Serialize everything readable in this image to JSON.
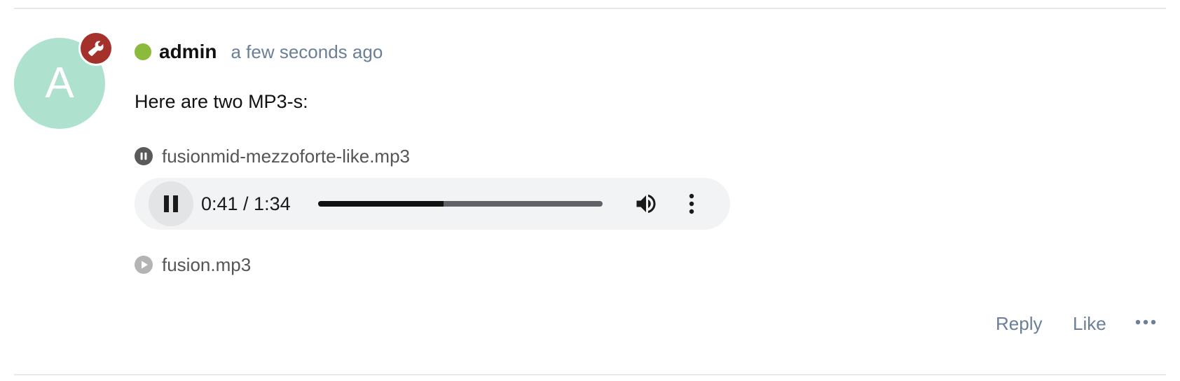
{
  "comment": {
    "avatar_letter": "A",
    "author": "admin",
    "timestamp": "a few seconds ago",
    "text": "Here are two MP3-s:",
    "presence_color": "#8bbb3d",
    "badge_icon": "wrench-icon",
    "badge_color": "#a5312b",
    "avatar_color": "#aee2cf"
  },
  "attachments": [
    {
      "name": "fusionmid-mezzoforte-like.mp3",
      "state_icon": "pause-circle-icon",
      "playing": true
    },
    {
      "name": "fusion.mp3",
      "state_icon": "play-circle-icon",
      "playing": false
    }
  ],
  "player": {
    "time_display": "0:41 / 1:34",
    "progress_fraction": 0.44,
    "control_icons": [
      "pause-icon",
      "volume-icon",
      "more-vertical-icon"
    ]
  },
  "actions": {
    "reply": "Reply",
    "like": "Like",
    "more_icon": "more-horizontal-icon"
  }
}
